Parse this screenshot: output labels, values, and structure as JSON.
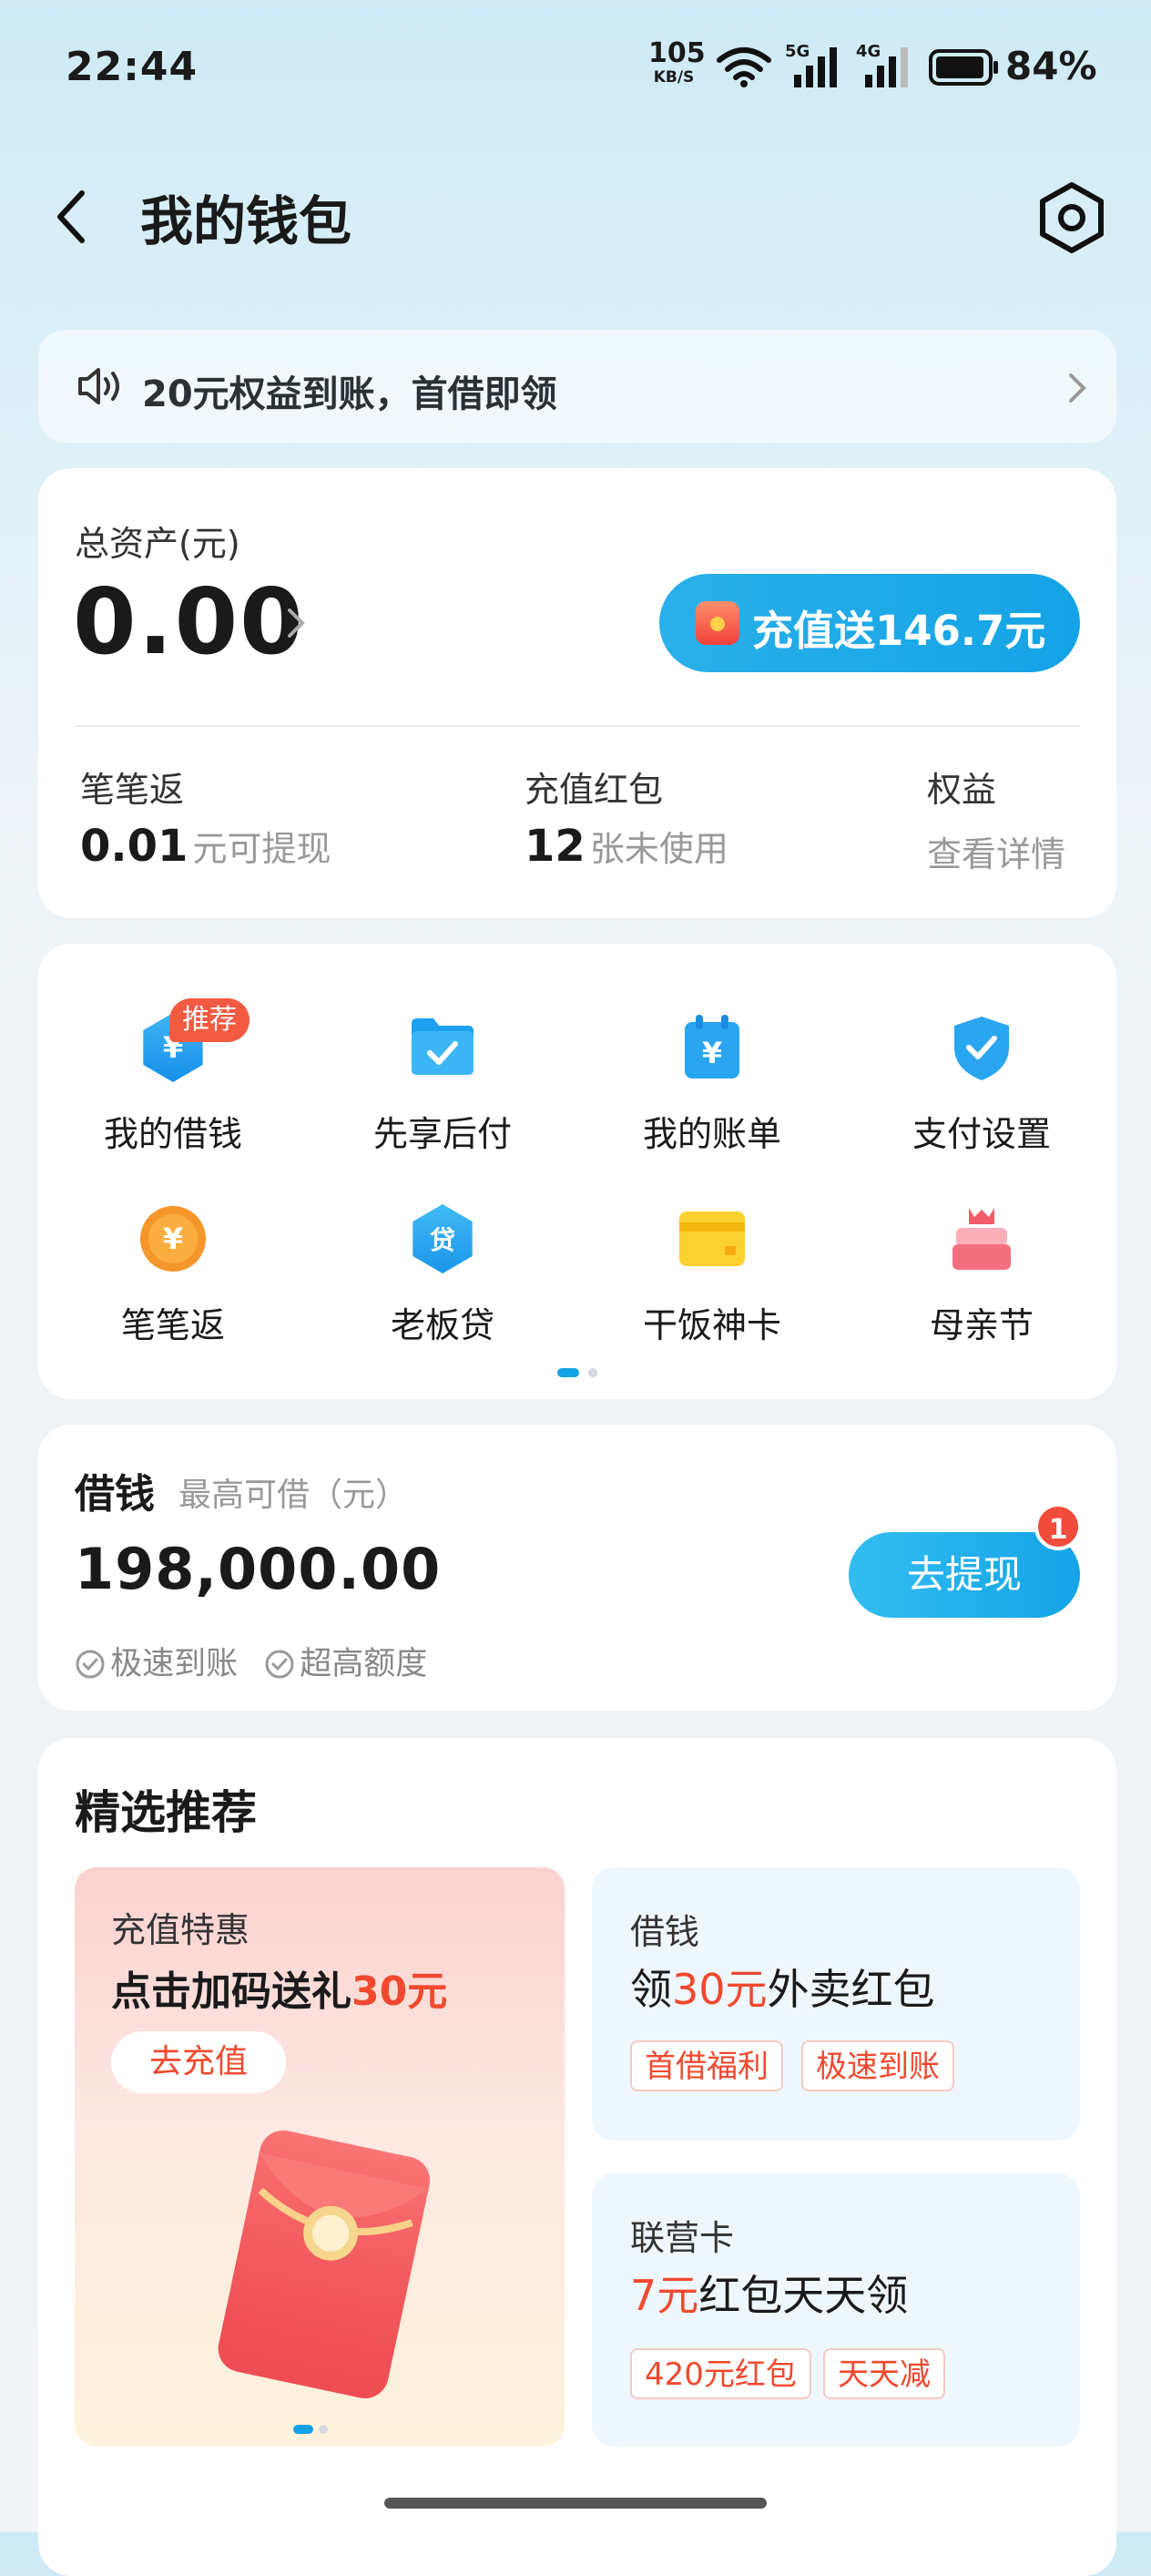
{
  "status_bar": {
    "time": "22:44",
    "net_speed_value": "105",
    "net_speed_unit": "KB/S",
    "signal_1": "5G",
    "signal_2": "4G",
    "battery": "84%"
  },
  "header": {
    "title": "我的钱包"
  },
  "notice": {
    "text": "20元权益到账，首借即领"
  },
  "assets": {
    "label": "总资产(元)",
    "value": "0.00",
    "recharge_button": "充值送146.7元",
    "items": [
      {
        "label": "笔笔返",
        "value": "0.01",
        "unit": "元可提现"
      },
      {
        "label": "充值红包",
        "value": "12",
        "unit": "张未使用"
      },
      {
        "label": "权益",
        "value": "",
        "unit": "查看详情"
      }
    ]
  },
  "features": {
    "items": [
      {
        "label": "我的借钱",
        "icon": "loan-hex-icon",
        "tag": "推荐"
      },
      {
        "label": "先享后付",
        "icon": "folder-check-icon"
      },
      {
        "label": "我的账单",
        "icon": "bill-calendar-icon"
      },
      {
        "label": "支付设置",
        "icon": "shield-check-icon"
      },
      {
        "label": "笔笔返",
        "icon": "cashback-coin-icon"
      },
      {
        "label": "老板贷",
        "icon": "boss-loan-icon",
        "glyph": "贷"
      },
      {
        "label": "干饭神卡",
        "icon": "yellow-card-icon"
      },
      {
        "label": "母亲节",
        "icon": "cake-icon"
      }
    ],
    "currency_glyph": "¥",
    "page": 1,
    "pages": 2
  },
  "loan": {
    "title": "借钱",
    "subtitle": "最高可借（元）",
    "amount": "198,000.00",
    "features": [
      "极速到账",
      "超高额度"
    ],
    "button": "去提现",
    "badge": "1"
  },
  "recommend": {
    "title": "精选推荐",
    "promo": {
      "small": "充值特惠",
      "big_prefix": "点击加码送礼",
      "big_highlight": "30元",
      "button": "去充值"
    },
    "card1": {
      "small": "借钱",
      "big_prefix": "领",
      "big_highlight": "30元",
      "big_suffix": "外卖红包",
      "chips": [
        "首借福利",
        "极速到账"
      ]
    },
    "card2": {
      "small": "联营卡",
      "big_highlight": "7元",
      "big_suffix": "红包天天领",
      "chips": [
        "420元红包",
        "天天减"
      ]
    }
  },
  "colors": {
    "accent_blue": "#14a3e6",
    "highlight_red": "#f0492f",
    "tag_red": "#f25a41"
  }
}
